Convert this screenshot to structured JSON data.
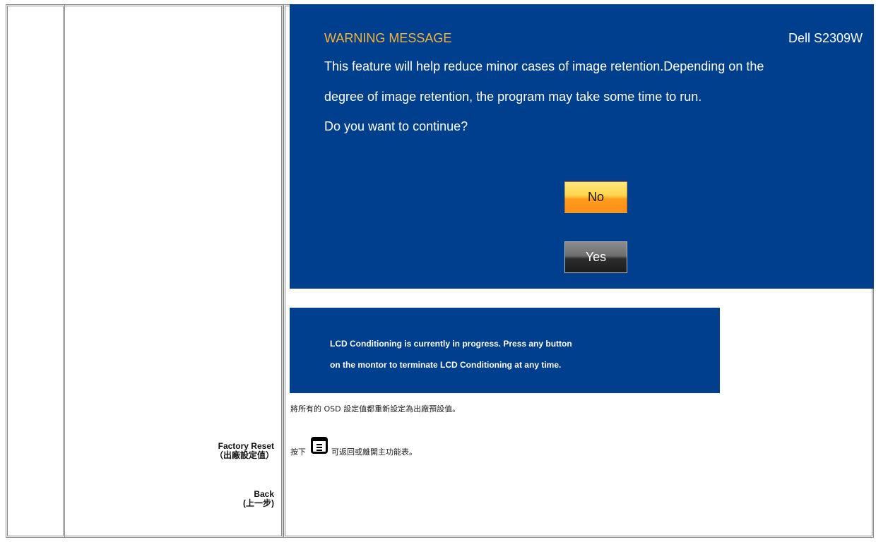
{
  "warning_osd": {
    "title": "WARNING MESSAGE",
    "model": "Dell S2309W",
    "lines": [
      "This feature will help reduce minor cases of image retention.Depending on the",
      "degree of image retention, the program may take some time to run.",
      "Do you want to continue?"
    ],
    "no_label": "No",
    "yes_label": "Yes"
  },
  "progress_osd": {
    "lines": [
      "LCD Conditioning is currently in progress. Press any button",
      "on the montor to terminate LCD Conditioning at any time."
    ]
  },
  "factory_reset": {
    "label": "Factory Reset",
    "label_zh": "（出廠設定值）",
    "description": "將所有的 OSD 設定值都重新設定為出廠預設值。"
  },
  "back": {
    "label": "Back",
    "label_zh": "(上一步)",
    "text_before": "按下",
    "text_after": "可返回或離開主功能表。"
  },
  "icons": {
    "menu_button": "menu-button-icon"
  },
  "colors": {
    "osd_background": "#003f8e",
    "title_color": "#f2b43a",
    "no_button": "#ffaa2b",
    "yes_button": "#4a4a4a"
  }
}
